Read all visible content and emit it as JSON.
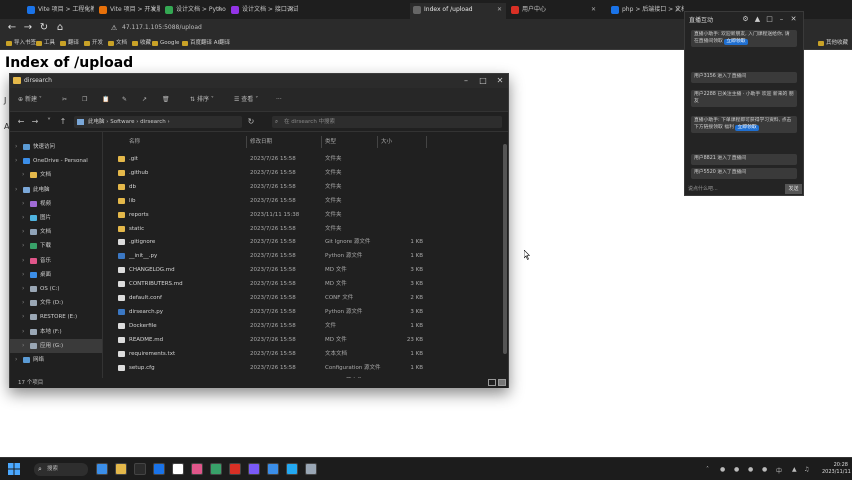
{
  "browser": {
    "tabs": [
      {
        "label": "Vite 项目 > 工程化教程",
        "color": "#1a73e8"
      },
      {
        "label": "Vite 项目 > 开发服务器配置",
        "color": "#e8710a"
      },
      {
        "label": "设计文档 > Python 文档 > 开发",
        "color": "#34a853"
      },
      {
        "label": "设计文档 > 接口调试 > 文档中心",
        "color": "#9334e6"
      },
      {
        "label": "Index of /upload",
        "color": "#666666"
      },
      {
        "label": "用户中心",
        "color": "#d93025"
      },
      {
        "label": "php > 后端接口 > 文档",
        "color": "#1a73e8"
      }
    ],
    "active_tab": 4,
    "url": "47.117.1.105:5088/upload",
    "bookmarks": [
      "导入书签",
      "工具",
      "翻译",
      "开发",
      "文档",
      "收藏",
      "Google",
      "百度翻译 AI翻译",
      "其他收藏"
    ]
  },
  "page": {
    "title": "Index of /upload",
    "sliver_1": "J",
    "sliver_2": "A"
  },
  "explorer": {
    "title": "dirsearch",
    "toolbar": {
      "new": "新建",
      "sort": "排序",
      "view": "查看",
      "more": "···"
    },
    "breadcrumb": [
      "此电脑",
      "Software",
      "dirsearch"
    ],
    "search_placeholder": "在 dirsearch 中搜索",
    "sidebar": [
      {
        "label": "快速访问",
        "color": "#5b9bd5",
        "indent": 0
      },
      {
        "label": "OneDrive - Personal",
        "color": "#3b8ee8",
        "indent": 0
      },
      {
        "label": "文档",
        "color": "#e4b84a",
        "indent": 1
      },
      {
        "label": "此电脑",
        "color": "#7aa7d8",
        "indent": 0
      },
      {
        "label": "视频",
        "color": "#a06bd5",
        "indent": 1
      },
      {
        "label": "图片",
        "color": "#4fb3e0",
        "indent": 1
      },
      {
        "label": "文档",
        "color": "#8fa3b8",
        "indent": 1
      },
      {
        "label": "下载",
        "color": "#38a169",
        "indent": 1
      },
      {
        "label": "音乐",
        "color": "#e0568a",
        "indent": 1
      },
      {
        "label": "桌面",
        "color": "#3b8ee8",
        "indent": 1
      },
      {
        "label": "OS (C:)",
        "color": "#9aa7b5",
        "indent": 1
      },
      {
        "label": "文件 (D:)",
        "color": "#9aa7b5",
        "indent": 1
      },
      {
        "label": "RESTORE (E:)",
        "color": "#9aa7b5",
        "indent": 1
      },
      {
        "label": "本地 (F:)",
        "color": "#9aa7b5",
        "indent": 1
      },
      {
        "label": "应用 (G:)",
        "color": "#9aa7b5",
        "indent": 1
      },
      {
        "label": "网络",
        "color": "#5b9bd5",
        "indent": 0
      }
    ],
    "columns": {
      "name": "名称",
      "date": "修改日期",
      "type": "类型",
      "size": "大小"
    },
    "files": [
      {
        "name": ".git",
        "date": "2023/7/26 15:58",
        "type": "文件夹",
        "size": "",
        "kind": "folder"
      },
      {
        "name": ".github",
        "date": "2023/7/26 15:58",
        "type": "文件夹",
        "size": "",
        "kind": "folder"
      },
      {
        "name": "db",
        "date": "2023/7/26 15:58",
        "type": "文件夹",
        "size": "",
        "kind": "folder"
      },
      {
        "name": "lib",
        "date": "2023/7/26 15:58",
        "type": "文件夹",
        "size": "",
        "kind": "folder"
      },
      {
        "name": "reports",
        "date": "2023/11/11 15:38",
        "type": "文件夹",
        "size": "",
        "kind": "folder"
      },
      {
        "name": "static",
        "date": "2023/7/26 15:58",
        "type": "文件夹",
        "size": "",
        "kind": "folder"
      },
      {
        "name": ".gitignore",
        "date": "2023/7/26 15:58",
        "type": "Git Ignore 源文件",
        "size": "1 KB",
        "kind": "file"
      },
      {
        "name": "__init__.py",
        "date": "2023/7/26 15:58",
        "type": "Python 源文件",
        "size": "1 KB",
        "kind": "py"
      },
      {
        "name": "CHANGELOG.md",
        "date": "2023/7/26 15:58",
        "type": "MD 文件",
        "size": "3 KB",
        "kind": "file"
      },
      {
        "name": "CONTRIBUTERS.md",
        "date": "2023/7/26 15:58",
        "type": "MD 文件",
        "size": "3 KB",
        "kind": "file"
      },
      {
        "name": "default.conf",
        "date": "2023/7/26 15:58",
        "type": "CONF 文件",
        "size": "2 KB",
        "kind": "file"
      },
      {
        "name": "dirsearch.py",
        "date": "2023/7/26 15:58",
        "type": "Python 源文件",
        "size": "3 KB",
        "kind": "py"
      },
      {
        "name": "Dockerfile",
        "date": "2023/7/26 15:58",
        "type": "文件",
        "size": "1 KB",
        "kind": "file"
      },
      {
        "name": "README.md",
        "date": "2023/7/26 15:58",
        "type": "MD 文件",
        "size": "23 KB",
        "kind": "file"
      },
      {
        "name": "requirements.txt",
        "date": "2023/7/26 15:58",
        "type": "文本文档",
        "size": "1 KB",
        "kind": "file"
      },
      {
        "name": "setup.cfg",
        "date": "2023/7/26 15:58",
        "type": "Configuration 源文件",
        "size": "1 KB",
        "kind": "file"
      },
      {
        "name": "setup.py",
        "date": "2023/7/26 15:58",
        "type": "Python 源文件",
        "size": "",
        "kind": "py"
      }
    ],
    "status": "17 个项目"
  },
  "chat": {
    "title": "直播互动",
    "messages": [
      {
        "text": "直播小助手: 欢迎新朋友, 入门课程送给你, 请在直播间领取",
        "tag": "立即领取"
      },
      {
        "text": "用户3156 进入了直播间",
        "tag": ""
      },
      {
        "text": "用户2288 已关注主播 · 小助手 欢迎 新来的 朋友",
        "tag": ""
      },
      {
        "text": "直播小助手: 下单课程即可获得学习资料, 点击下方链接领取 福利",
        "tag": "立即领取"
      },
      {
        "text": "用户8821 进入了直播间",
        "tag": ""
      },
      {
        "text": "用户5520 进入了直播间",
        "tag": ""
      }
    ],
    "input_placeholder": "说点什么吧...",
    "send_label": "发送"
  },
  "taskbar": {
    "search_label": "搜索",
    "apps": [
      "#3b8ee8",
      "#e4b84a",
      "#2b2b2b",
      "#1a73e8",
      "#ffffff",
      "#e0568a",
      "#38a169",
      "#d93025",
      "#7a5af8",
      "#3b8ee8",
      "#23a9f2",
      "#9aa7b5"
    ],
    "time": "20:28",
    "date": "2023/11/11"
  }
}
